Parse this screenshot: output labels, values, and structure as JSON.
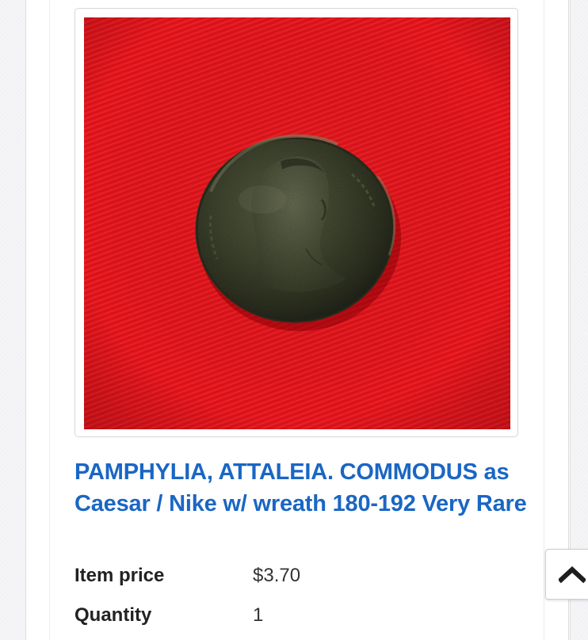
{
  "product": {
    "image_alt": "Ancient bronze coin on red cloth",
    "title": "PAMPHYLIA, ATTALEIA. COMMODUS as Caesar / Nike w/ wreath 180-192 Very Rare"
  },
  "details": {
    "price_label": "Item price",
    "price_value": "$3.70",
    "quantity_label": "Quantity",
    "quantity_value": "1"
  },
  "icons": {
    "back_to_top": "chevron-up-icon"
  },
  "colors": {
    "title_link": "#1a66c4",
    "photo_background": "#e3121a"
  }
}
